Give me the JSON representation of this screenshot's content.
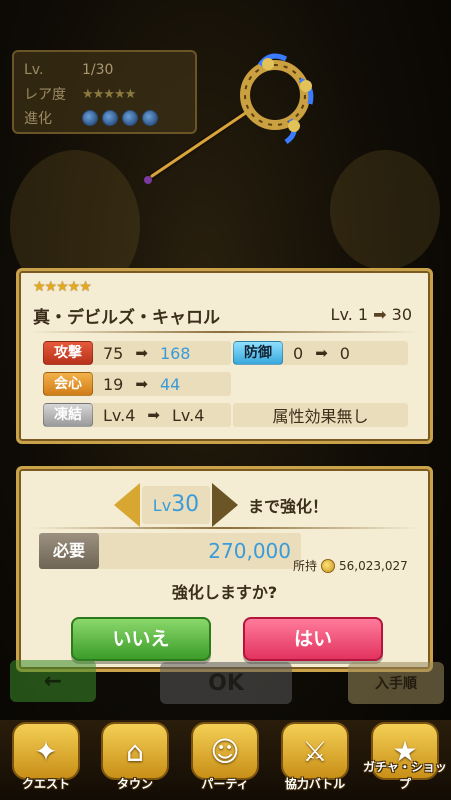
{
  "status_panel": {
    "lv_label": "Lv.",
    "lv_value": "1/30",
    "rarity_label": "レア度",
    "rarity_stars": "★★★★★",
    "evolution_label": "進化"
  },
  "item": {
    "stars": "★★★★★",
    "name": "真・デビルズ・キャロル",
    "level_from": "Lv. 1",
    "level_arrow": "➡",
    "level_to": "30",
    "stats": [
      {
        "label": "攻撃",
        "from": "75",
        "to": "168"
      },
      {
        "label": "防御",
        "from": "0",
        "to": "0"
      },
      {
        "label": "会心",
        "from": "19",
        "to": "44"
      },
      {
        "label": "凍結",
        "from": "Lv.4",
        "to": "Lv.4"
      }
    ],
    "attribute_effect": "属性効果無し"
  },
  "enhance": {
    "lv_prefix": "Lv",
    "lv_target": "30",
    "until_text": "まで強化！",
    "required_label": "必要",
    "required_value": "270,000",
    "owned_label": "所持",
    "owned_value": "56,023,027",
    "question": "強化しますか?",
    "no_button": "いいえ",
    "yes_button": "はい"
  },
  "background_buttons": {
    "back": "←",
    "ok": "OK",
    "order": "入手順"
  },
  "nav": [
    {
      "label": "クエスト",
      "icon": "quest-map-icon"
    },
    {
      "label": "タウン",
      "icon": "town-icon"
    },
    {
      "label": "パーティ",
      "icon": "party-icon"
    },
    {
      "label": "協力バトル",
      "icon": "coop-battle-icon"
    },
    {
      "label": "ガチャ・ショップ",
      "icon": "gacha-shop-icon"
    }
  ],
  "colors": {
    "dialog_bg": "#f4ecd3",
    "dialog_border": "#c9a24a",
    "new_value": "#3a9bd8",
    "no_button": "#3c9c2a",
    "yes_button": "#e2335f"
  }
}
